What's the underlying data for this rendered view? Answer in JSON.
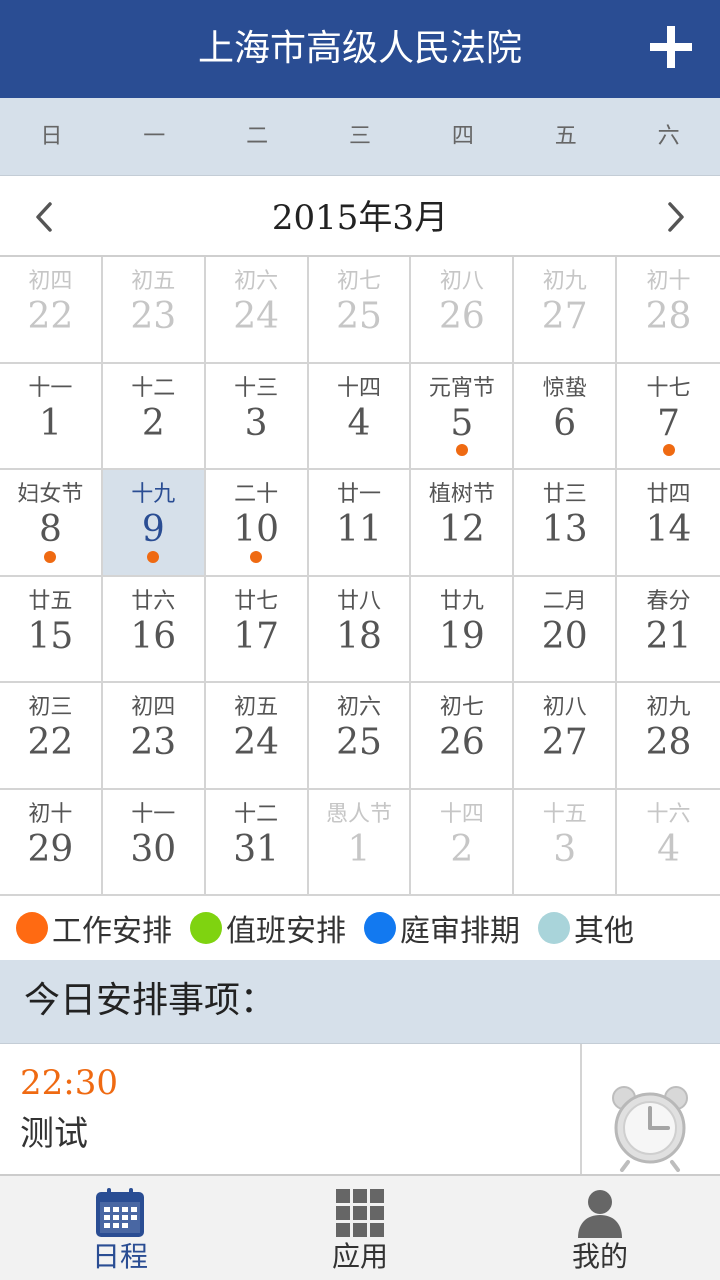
{
  "header": {
    "title": "上海市高级人民法院"
  },
  "weekdays": [
    "日",
    "一",
    "二",
    "三",
    "四",
    "五",
    "六"
  ],
  "calendar": {
    "month_title": "2015年3月",
    "cells": [
      {
        "lunar": "初四",
        "day": "22",
        "dim": true
      },
      {
        "lunar": "初五",
        "day": "23",
        "dim": true
      },
      {
        "lunar": "初六",
        "day": "24",
        "dim": true
      },
      {
        "lunar": "初七",
        "day": "25",
        "dim": true
      },
      {
        "lunar": "初八",
        "day": "26",
        "dim": true
      },
      {
        "lunar": "初九",
        "day": "27",
        "dim": true
      },
      {
        "lunar": "初十",
        "day": "28",
        "dim": true
      },
      {
        "lunar": "十一",
        "day": "1"
      },
      {
        "lunar": "十二",
        "day": "2"
      },
      {
        "lunar": "十三",
        "day": "3"
      },
      {
        "lunar": "十四",
        "day": "4"
      },
      {
        "lunar": "元宵节",
        "day": "5",
        "dot": "#ef6a12"
      },
      {
        "lunar": "惊蛰",
        "day": "6"
      },
      {
        "lunar": "十七",
        "day": "7",
        "dot": "#ef6a12"
      },
      {
        "lunar": "妇女节",
        "day": "8",
        "dot": "#ef6a12"
      },
      {
        "lunar": "十九",
        "day": "9",
        "dot": "#ef6a12",
        "selected": true
      },
      {
        "lunar": "二十",
        "day": "10",
        "dot": "#ef6a12"
      },
      {
        "lunar": "廿一",
        "day": "11"
      },
      {
        "lunar": "植树节",
        "day": "12"
      },
      {
        "lunar": "廿三",
        "day": "13"
      },
      {
        "lunar": "廿四",
        "day": "14"
      },
      {
        "lunar": "廿五",
        "day": "15"
      },
      {
        "lunar": "廿六",
        "day": "16"
      },
      {
        "lunar": "廿七",
        "day": "17"
      },
      {
        "lunar": "廿八",
        "day": "18"
      },
      {
        "lunar": "廿九",
        "day": "19"
      },
      {
        "lunar": "二月",
        "day": "20"
      },
      {
        "lunar": "春分",
        "day": "21"
      },
      {
        "lunar": "初三",
        "day": "22"
      },
      {
        "lunar": "初四",
        "day": "23"
      },
      {
        "lunar": "初五",
        "day": "24"
      },
      {
        "lunar": "初六",
        "day": "25"
      },
      {
        "lunar": "初七",
        "day": "26"
      },
      {
        "lunar": "初八",
        "day": "27"
      },
      {
        "lunar": "初九",
        "day": "28"
      },
      {
        "lunar": "初十",
        "day": "29"
      },
      {
        "lunar": "十一",
        "day": "30"
      },
      {
        "lunar": "十二",
        "day": "31"
      },
      {
        "lunar": "愚人节",
        "day": "1",
        "dim": true
      },
      {
        "lunar": "十四",
        "day": "2",
        "dim": true
      },
      {
        "lunar": "十五",
        "day": "3",
        "dim": true
      },
      {
        "lunar": "十六",
        "day": "4",
        "dim": true
      }
    ]
  },
  "legend": [
    {
      "label": "工作安排",
      "color": "#ff6a12"
    },
    {
      "label": "值班安排",
      "color": "#7fd310"
    },
    {
      "label": "庭审排期",
      "color": "#1279f0"
    },
    {
      "label": "其他",
      "color": "#a9d4da"
    }
  ],
  "today": {
    "title": "今日安排事项：",
    "event": {
      "time": "22:30",
      "name": "测试"
    }
  },
  "tabs": [
    {
      "label": "日程",
      "icon": "calendar-icon",
      "active": true
    },
    {
      "label": "应用",
      "icon": "grid-apps-icon",
      "active": false
    },
    {
      "label": "我的",
      "icon": "user-icon",
      "active": false
    }
  ],
  "colors": {
    "header_bg": "#2a4d93",
    "band_bg": "#d6e0ea",
    "accent_orange": "#ef6a12"
  }
}
